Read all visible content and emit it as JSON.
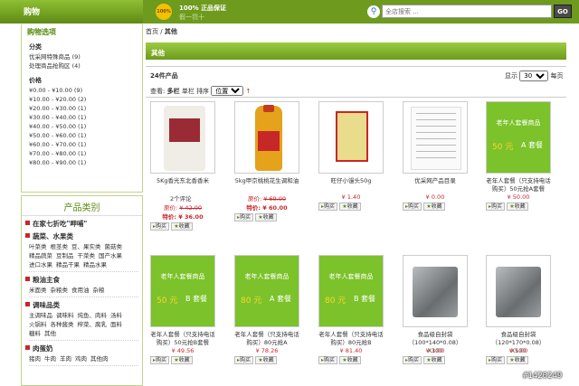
{
  "topbar": {
    "cart_label": "购物",
    "seal_text": "100%",
    "guarantee": "100% 正品保证",
    "guarantee_sub": "假一罚十",
    "search_placeholder": "全店搜索 ...",
    "go_label": "GO"
  },
  "sidebar": {
    "options_title": "购物选项",
    "category_title": "分类",
    "categories": [
      "优采网特殊商品 (9)",
      "处理商品抢购区 (4)"
    ],
    "price_title": "价格",
    "prices": [
      "¥0.00 - ¥10.00 (9)",
      "¥10.00 - ¥20.00 (2)",
      "¥20.00 - ¥30.00 (1)",
      "¥30.00 - ¥40.00 (1)",
      "¥40.00 - ¥50.00 (1)",
      "¥50.00 - ¥60.00 (1)",
      "¥60.00 - ¥70.00 (1)",
      "¥70.00 - ¥80.00 (1)",
      "¥80.00 - ¥90.00 (1)"
    ],
    "product_cat_title": "产品类别",
    "groups": [
      {
        "name": "在家七折吃\"呷哺\"",
        "subs": []
      },
      {
        "name": "蔬菜、水果类",
        "subs": [
          "叶菜类",
          "根茎类",
          "豆、果实类",
          "菌菇类",
          "精品蔬菜",
          "豆制品",
          "干菜类",
          "国产水果",
          "进口水果",
          "精品干果",
          "精品水果"
        ]
      },
      {
        "name": "粮油主食",
        "subs": [
          "米面类",
          "杂粮类",
          "食用油",
          "杂粮"
        ]
      },
      {
        "name": "调味品类",
        "subs": [
          "主调味品",
          "调味料",
          "炖鱼、肉料",
          "汤料",
          "火锅料",
          "各种酱类",
          "榨菜、腐乳",
          "面料",
          "糖料",
          "其他"
        ]
      },
      {
        "name": "肉蛋奶",
        "subs": [
          "猪肉",
          "牛肉",
          "羊肉",
          "鸡肉",
          "其他肉"
        ]
      }
    ]
  },
  "main": {
    "breadcrumb_home": "首页",
    "breadcrumb_sep": "/",
    "breadcrumb_current": "其他",
    "tab_title": "其他",
    "count_text": "24件产品",
    "show_label": "显示",
    "per_page": "30",
    "per_page_suffix": "每页",
    "view_label": "查看:",
    "view_multi": "多栏",
    "view_single": "单栏",
    "sort_label": "排序",
    "sort_value": "位置",
    "sort_arrow": "↑"
  },
  "products": [
    {
      "name": "5Kg香光东北香香米",
      "reviews": "2个评论",
      "orig_label": "原价:",
      "orig_price": "¥ 42.00",
      "sale_label": "特价:",
      "sale_price": "¥ 36.00",
      "buy": "购买",
      "fav": "收藏",
      "img": "rice"
    },
    {
      "name": "5kg甲京桃桃花生调和油",
      "reviews": "",
      "orig_label": "原价:",
      "orig_price": "¥ 69.00",
      "sale_label": "特价:",
      "sale_price": "¥ 60.00",
      "buy": "购买",
      "fav": "收藏",
      "img": "oil"
    },
    {
      "name": "旺仔小馒头50g",
      "reviews": "",
      "price": "¥ 1.40",
      "buy": "购买",
      "fav": "收藏",
      "img": "snack"
    },
    {
      "name": "优采网产品目录",
      "reviews": "",
      "price": "¥ 0.00",
      "buy": "购买",
      "fav": "收藏",
      "img": "doc"
    },
    {
      "name": "老年人套餐（只支持电话购买）50元抢A套餐",
      "reviews": "",
      "price": "¥ 50.00",
      "buy": "购买",
      "fav": "收藏",
      "img": "green",
      "ad_title": "老年人套餐商品",
      "ad_price": "50 元",
      "ad_pack": "A 套餐"
    },
    {
      "name": "老年人套餐（只支持电话购买）50元抢B套餐",
      "reviews": "",
      "price": "¥ 49.56",
      "buy": "购买",
      "fav": "收藏",
      "img": "green",
      "ad_title": "老年人套餐商品",
      "ad_price": "50 元",
      "ad_pack": "B 套餐"
    },
    {
      "name": "老年人套餐（只支持电话购买）80元抢A",
      "reviews": "",
      "price": "¥ 78.26",
      "buy": "购买",
      "fav": "收藏",
      "img": "green",
      "ad_title": "老年人套餐商品",
      "ad_price": "80 元",
      "ad_pack": "A 套餐"
    },
    {
      "name": "老年人套餐（只支持电话购买）80元抢B",
      "reviews": "",
      "price": "¥ 81.40",
      "buy": "购买",
      "fav": "收藏",
      "img": "green",
      "ad_title": "老年人套餐商品",
      "ad_price": "80 元",
      "ad_pack": "B 套餐"
    },
    {
      "name": "食品级自封袋（100*140*0.08）X100",
      "reviews": "",
      "price": "¥ 3.00",
      "buy": "购买",
      "fav": "收藏",
      "img": "bag"
    },
    {
      "name": "食品级自封袋（120*170*0.08）X100",
      "reviews": "",
      "price": "¥ 5.00",
      "buy": "购买",
      "fav": "收藏",
      "img": "bag"
    }
  ],
  "watermark": "#1420249"
}
